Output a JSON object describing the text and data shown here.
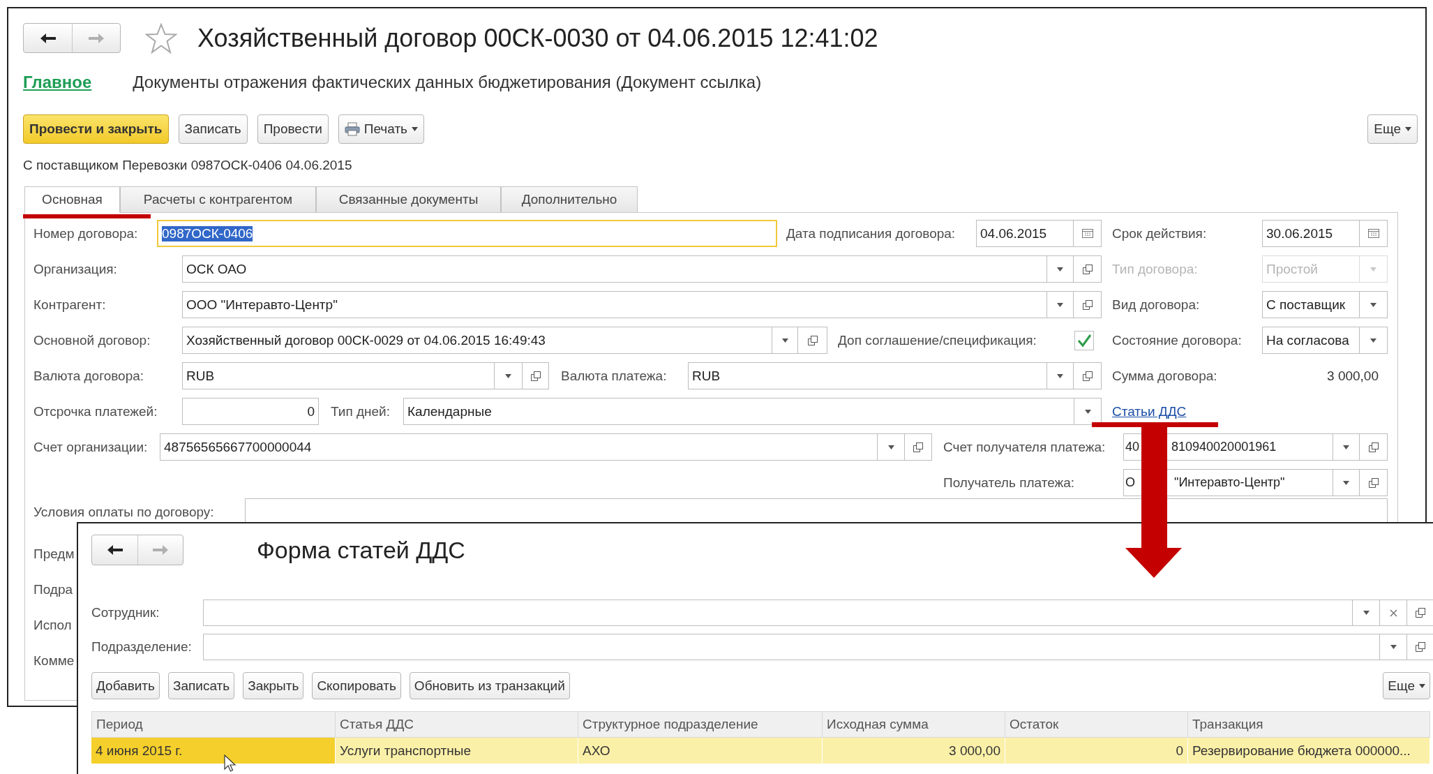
{
  "main_window": {
    "title": "Хозяйственный договор 00СК-0030 от 04.06.2015 12:41:02",
    "section_link": "Главное",
    "subtitle": "Документы отражения фактических данных бюджетирования (Документ ссылка)",
    "toolbar": [
      {
        "label": "Провести и закрыть",
        "kind": "primary"
      },
      {
        "label": "Записать",
        "kind": "plain"
      },
      {
        "label": "Провести",
        "kind": "plain"
      },
      {
        "label": "Печать",
        "kind": "print-menu"
      }
    ],
    "more_button": "Еще",
    "caption": "С поставщиком Перевозки 0987ОСК-0406 04.06.2015",
    "tabs": [
      {
        "label": "Основная",
        "selected": true
      },
      {
        "label": "Расчеты с контрагентом",
        "selected": false
      },
      {
        "label": "Связанные документы",
        "selected": false
      },
      {
        "label": "Дополнительно",
        "selected": false
      }
    ],
    "fields": {
      "contract_number": {
        "label": "Номер договора:",
        "value": "0987ОСК-0406"
      },
      "signing_date": {
        "label": "Дата подписания договора:",
        "value": "04.06.2015"
      },
      "valid_until": {
        "label": "Срок действия:",
        "value": "30.06.2015"
      },
      "organization": {
        "label": "Организация:",
        "value": "ОСК ОАО"
      },
      "contract_type": {
        "label": "Тип договора:",
        "value": "Простой",
        "disabled": true
      },
      "counterparty": {
        "label": "Контрагент:",
        "value": "ООО \"Интеравто-Центр\""
      },
      "contract_kind": {
        "label": "Вид договора:",
        "value": "С поставщик",
        "disabled": false
      },
      "main_contract": {
        "label": "Основной договор:",
        "value": "Хозяйственный договор 00СК-0029 от 04.06.2015 16:49:43"
      },
      "supplement": {
        "label": "Доп соглашение/спецификация:",
        "checked": true
      },
      "contract_state": {
        "label": "Состояние договора:",
        "value": "На согласова"
      },
      "contract_currency": {
        "label": "Валюта договора:",
        "value": "RUB"
      },
      "payment_currency": {
        "label": "Валюта платежа:",
        "value": "RUB"
      },
      "contract_sum": {
        "label": "Сумма договора:",
        "value": "3 000,00"
      },
      "payment_delay": {
        "label": "Отсрочка платежей:",
        "value": "0"
      },
      "day_type": {
        "label": "Тип дней:",
        "value": "Календарные"
      },
      "cashflow_link": "Статьи ДДС",
      "org_account": {
        "label": "Счет организации:",
        "value": "48756565667700000044"
      },
      "recipient_account": {
        "label": "Счет получателя платежа:",
        "value_parts": [
          "40",
          "810940020001961"
        ]
      },
      "recipient": {
        "label": "Получатель платежа:",
        "value_parts": [
          "О",
          "\"Интеравто-Центр\""
        ]
      },
      "payment_terms": {
        "label": "Условия оплаты по договору:"
      },
      "covered_labels": [
        "Предм",
        "Подра",
        "Испол",
        "Комме"
      ]
    }
  },
  "dds_window": {
    "title": "Форма статей ДДС",
    "filters": [
      {
        "label": "Сотрудник:",
        "clearable": true
      },
      {
        "label": "Подразделение:",
        "clearable": false
      }
    ],
    "buttons": [
      "Добавить",
      "Записать",
      "Закрыть",
      "Скопировать",
      "Обновить из транзакций"
    ],
    "more_button": "Еще",
    "table": {
      "columns": [
        {
          "label": "Период",
          "numeric": false
        },
        {
          "label": "Статья ДДС",
          "numeric": false
        },
        {
          "label": "Структурное подразделение",
          "numeric": false
        },
        {
          "label": "Исходная сумма",
          "numeric": true
        },
        {
          "label": "Остаток",
          "numeric": true
        },
        {
          "label": "Транзакция",
          "numeric": false
        }
      ],
      "rows": [
        {
          "selected": true,
          "cells": [
            "4 июня 2015 г.",
            "Услуги транспортные",
            "АХО",
            "3 000,00",
            "0",
            "Резервирование бюджета 000000..."
          ]
        }
      ]
    }
  }
}
